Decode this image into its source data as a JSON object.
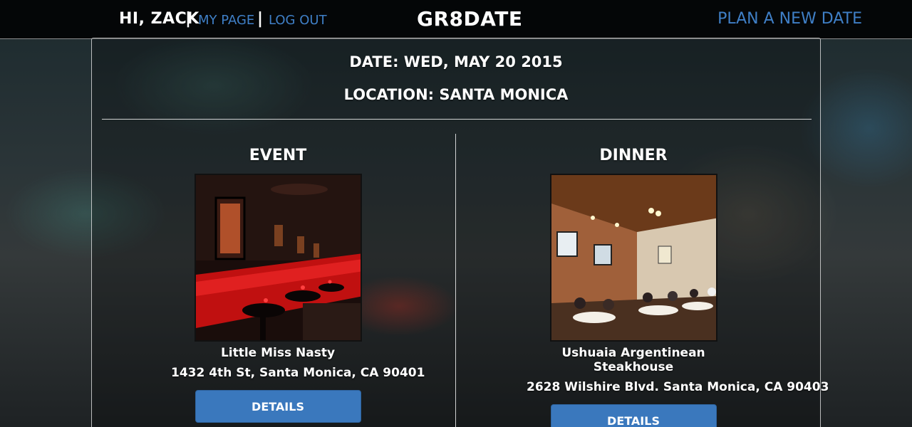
{
  "header": {
    "greeting": "HI, ZACK",
    "separator": "|",
    "my_page": "MY PAGE",
    "log_out": "LOG OUT",
    "brand": "GR8DATE",
    "plan_new_date": "PLAN A NEW DATE"
  },
  "date_info": {
    "date": "DATE: WED, MAY 20 2015",
    "location": "LOCATION: SANTA MONICA"
  },
  "event": {
    "title": "EVENT",
    "name": "Little Miss Nasty",
    "address": "1432 4th St, Santa Monica, CA 90401",
    "button": "DETAILS"
  },
  "dinner": {
    "title": "DINNER",
    "name": "Ushuaia Argentinean Steakhouse",
    "address": "2628 Wilshire Blvd. Santa Monica, CA 90403",
    "button": "DETAILS"
  },
  "colors": {
    "link": "#3f7fc6",
    "button": "#3a78bd"
  }
}
